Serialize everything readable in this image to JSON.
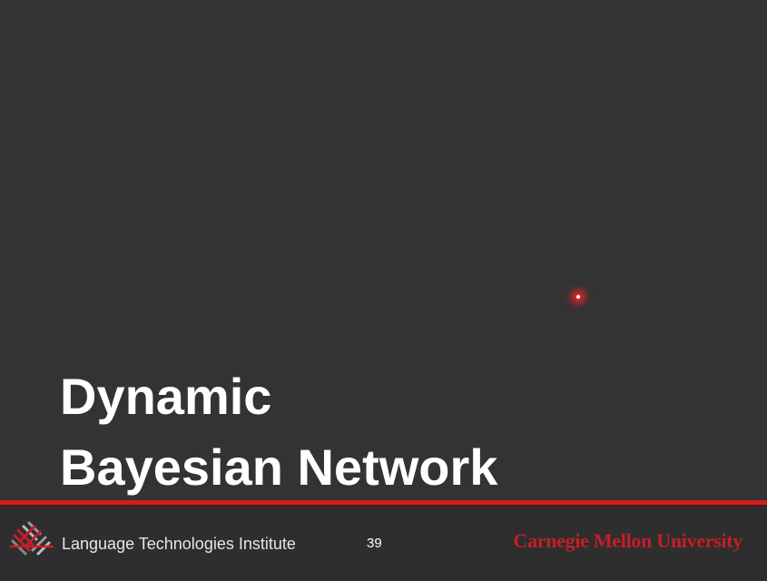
{
  "slide": {
    "title_line1": "Dynamic",
    "title_line2": "Bayesian Network"
  },
  "footer": {
    "institute": "Language Technologies Institute",
    "page_number": "39",
    "university": "Carnegie Mellon University"
  },
  "colors": {
    "background": "#333333",
    "accent_red": "#cc1f1f",
    "title_text": "#ffffff",
    "university_red": "#c41e26"
  },
  "icons": {
    "institute_logo": "lti-logo-icon",
    "pointer": "laser-pointer-icon"
  }
}
